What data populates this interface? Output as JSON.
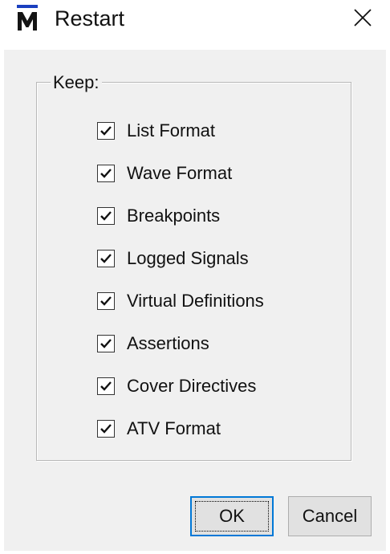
{
  "window": {
    "title": "Restart",
    "icon": "modelsim-m-icon",
    "close_icon": "close-icon"
  },
  "group": {
    "label": "Keep:"
  },
  "checkboxes": [
    {
      "label": "List Format",
      "checked": true
    },
    {
      "label": "Wave Format",
      "checked": true
    },
    {
      "label": "Breakpoints",
      "checked": true
    },
    {
      "label": "Logged Signals",
      "checked": true
    },
    {
      "label": "Virtual Definitions",
      "checked": true
    },
    {
      "label": "Assertions",
      "checked": true
    },
    {
      "label": "Cover Directives",
      "checked": true
    },
    {
      "label": "ATV Format",
      "checked": true
    }
  ],
  "buttons": {
    "ok_label": "OK",
    "cancel_label": "Cancel"
  },
  "colors": {
    "title_accent": "#1a3fbf",
    "dialog_background": "#f0f0f0",
    "focus_border": "#0078d7"
  }
}
